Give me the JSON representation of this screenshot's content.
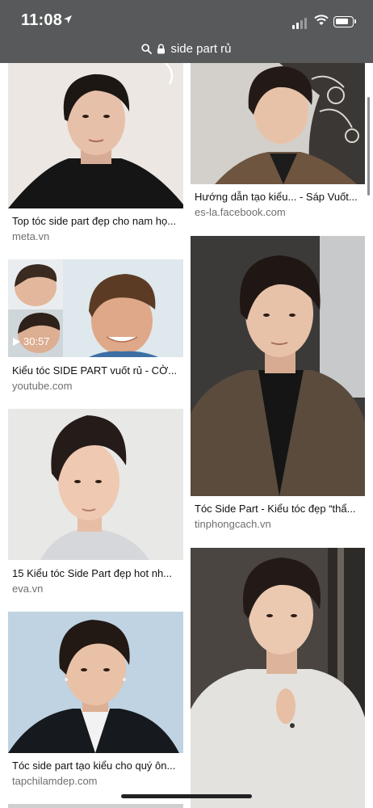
{
  "status_bar": {
    "time": "11:08"
  },
  "address_bar": {
    "query": "side part rủ"
  },
  "results": [
    {
      "caption": "Top tóc side part đẹp cho nam họ...",
      "source": "meta.vn"
    },
    {
      "caption": "Kiểu tóc SIDE PART vuốt rủ - CỜ...",
      "source": "youtube.com",
      "duration": "30:57"
    },
    {
      "caption": "15 Kiểu tóc Side Part đẹp hot nh...",
      "source": "eva.vn"
    },
    {
      "caption": "Tóc side part tạo kiểu cho quý ôn...",
      "source": "tapchilamdep.com"
    },
    {
      "caption": "Hướng dẫn tạo kiểu... - Sáp Vuốt...",
      "source": "es-la.facebook.com"
    },
    {
      "caption": "Tóc Side Part - Kiểu tóc đẹp “thẩ...",
      "source": "tinphongcach.vn"
    }
  ]
}
